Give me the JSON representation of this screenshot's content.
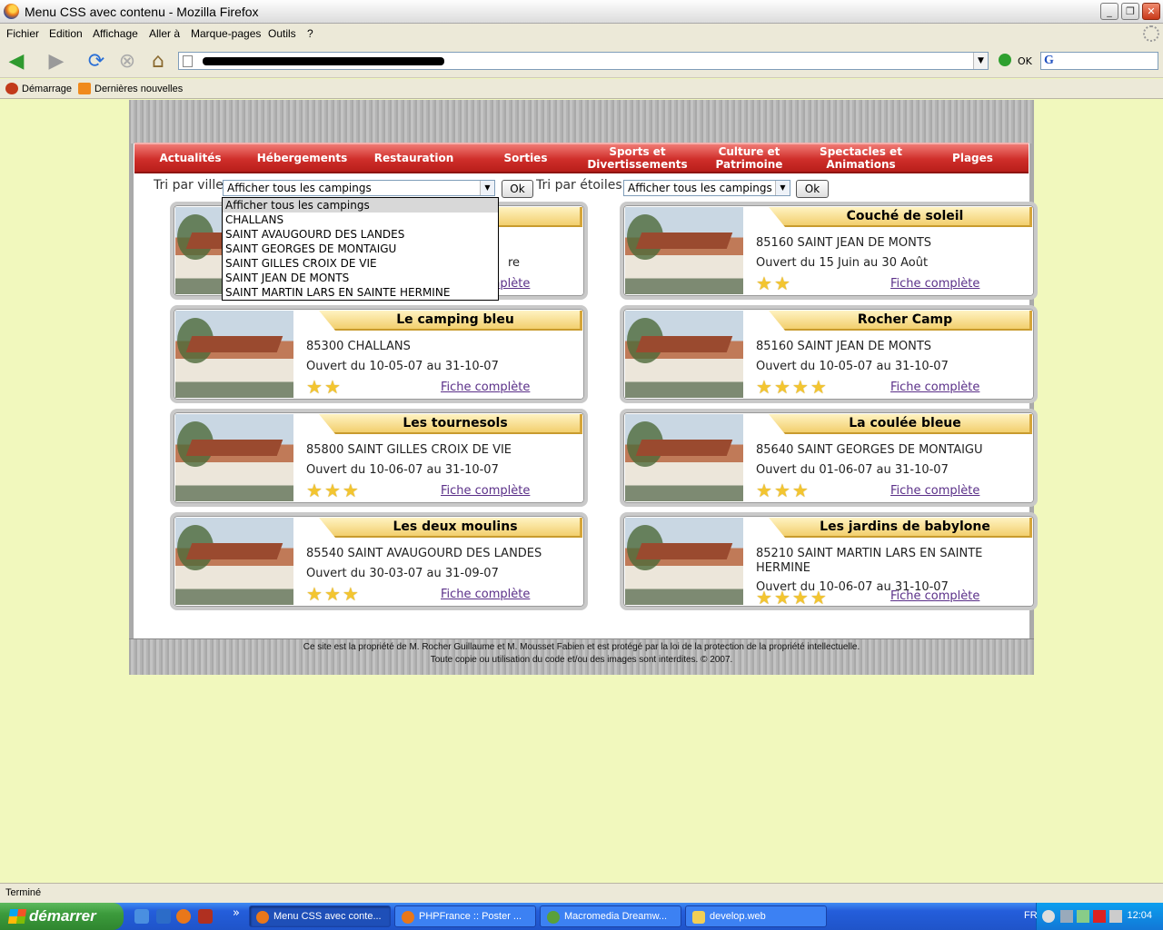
{
  "window": {
    "title": "Menu CSS avec contenu - Mozilla Firefox",
    "controls": {
      "minimize": "_",
      "restore": "❐",
      "close": "✕"
    }
  },
  "menubar": [
    "Fichier",
    "Edition",
    "Affichage",
    "Aller à",
    "Marque-pages",
    "Outils",
    "?"
  ],
  "navbar": {
    "go_label": "OK",
    "icons": [
      "back-icon",
      "forward-icon",
      "reload-icon",
      "stop-icon",
      "home-icon"
    ]
  },
  "bookmarks": [
    "Démarrage",
    "Dernières nouvelles"
  ],
  "site": {
    "nav": [
      {
        "label": "Actualités"
      },
      {
        "label": "Hébergements"
      },
      {
        "label": "Restauration"
      },
      {
        "label": "Sorties"
      },
      {
        "label": "Sports et Divertissements"
      },
      {
        "label": "Culture et Patrimoine"
      },
      {
        "label": "Spectacles et Animations"
      },
      {
        "label": "Plages"
      }
    ],
    "filters": {
      "city_label": "Tri par ville",
      "city_selected": "Afficher tous les campings",
      "stars_label": "Tri par étoiles",
      "stars_selected": "Afficher tous les campings",
      "ok_label": "Ok",
      "city_options": [
        "Afficher tous les campings",
        "CHALLANS",
        "SAINT AVAUGOURD DES LANDES",
        "SAINT GEORGES DE MONTAIGU",
        "SAINT GILLES CROIX DE VIE",
        "SAINT JEAN DE MONTS",
        "SAINT MARTIN LARS EN SAINTE HERMINE"
      ]
    },
    "link_label": "Fiche complète",
    "campings": [
      {
        "name": "",
        "address": "",
        "dates": "re",
        "stars": 0,
        "hidden": true
      },
      {
        "name": "Couché de soleil",
        "address": "85160 SAINT JEAN DE MONTS",
        "dates": "Ouvert du 15 Juin au 30 Août",
        "stars": 2
      },
      {
        "name": "Le camping bleu",
        "address": "85300 CHALLANS",
        "dates": "Ouvert du 10-05-07 au 31-10-07",
        "stars": 2
      },
      {
        "name": "Rocher Camp",
        "address": "85160 SAINT JEAN DE MONTS",
        "dates": "Ouvert du 10-05-07 au 31-10-07",
        "stars": 4
      },
      {
        "name": "Les tournesols",
        "address": "85800 SAINT GILLES CROIX DE VIE",
        "dates": "Ouvert du 10-06-07 au 31-10-07",
        "stars": 3
      },
      {
        "name": "La coulée bleue",
        "address": "85640 SAINT GEORGES DE MONTAIGU",
        "dates": "Ouvert du 01-06-07 au 31-10-07",
        "stars": 3
      },
      {
        "name": "Les deux moulins",
        "address": "85540 SAINT AVAUGOURD DES LANDES",
        "dates": "Ouvert du 30-03-07 au 31-09-07",
        "stars": 3
      },
      {
        "name": "Les jardins de babylone",
        "address": "85210 SAINT MARTIN LARS EN SAINTE HERMINE",
        "dates": "Ouvert du 10-06-07 au 31-10-07",
        "stars": 4
      }
    ],
    "footer_line1": "Ce site est la propriété de M. Rocher Guillaume et M. Mousset Fabien et est protégé par la loi de la protection de la propriété intellectuelle.",
    "footer_line2": "Toute copie ou utilisation du code et/ou des images sont interdites. © 2007."
  },
  "status": "Terminé",
  "taskbar": {
    "start": "démarrer",
    "tasks": [
      {
        "label": "Menu CSS avec conte...",
        "active": true
      },
      {
        "label": "PHPFrance :: Poster ...",
        "active": false
      },
      {
        "label": "Macromedia Dreamw...",
        "active": false
      },
      {
        "label": "develop.web",
        "active": false
      }
    ],
    "lang": "FR",
    "clock": "12:04"
  },
  "colors": {
    "page_bg": "#f1f8bd",
    "nav_red": "#cf2e2a",
    "ribbon": "#f2cf6e",
    "link": "#5a2f88",
    "star": "#f3c530"
  }
}
